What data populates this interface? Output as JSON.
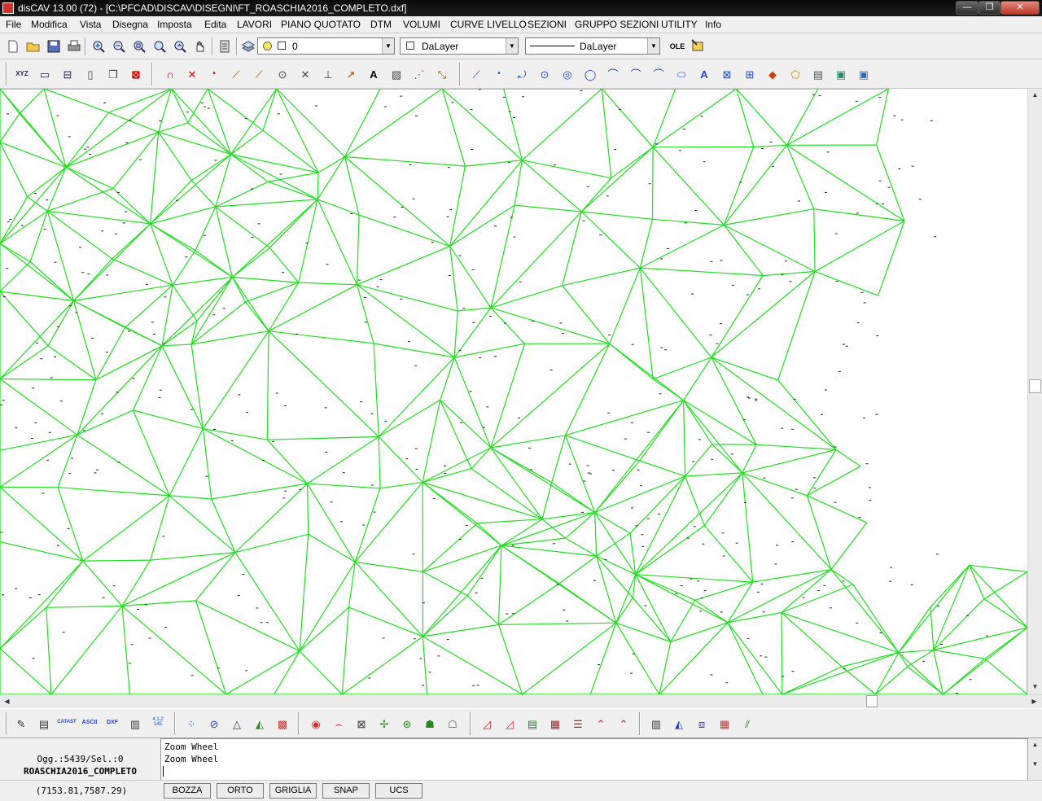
{
  "window": {
    "title": "disCAV 13.00 (72) - [C:\\PFCAD\\DISCAV\\DISEGNI\\FT_ROASCHIA2016_COMPLETO.dxf]",
    "minimize": "—",
    "restore": "❐",
    "close": "✕"
  },
  "menu": [
    "File",
    "Modifica",
    "Vista",
    "Disegna",
    "Imposta",
    "Edita",
    "LAVORI",
    "PIANO QUOTATO",
    "DTM",
    "VOLUMI",
    "CURVE LIVELLO",
    "SEZIONI",
    "GRUPPO SEZIONI",
    "UTILITY",
    "Info"
  ],
  "toolbar1": {
    "layer_value": "0",
    "color_value": "DaLayer",
    "linetype_value": "DaLayer",
    "ole_label": "OLE",
    "icons": [
      "new-icon",
      "open-icon",
      "save-icon",
      "print-icon",
      "zoom-in-icon",
      "zoom-out-icon",
      "zoom-window-icon",
      "zoom-extents-icon",
      "zoom-previous-icon",
      "pan-icon",
      "properties-icon",
      "layers-icon"
    ]
  },
  "toolbar2": {
    "icons": [
      "xyz-icon",
      "dimension-icon",
      "layer-tool-icon",
      "page-icon",
      "page-copy-icon",
      "delete-icon",
      "magnet-icon",
      "point-x-icon",
      "point-dot-icon",
      "line-icon",
      "line2-icon",
      "circle-icon",
      "cross-icon",
      "perpendicular-icon",
      "arrow-icon",
      "text-a-icon",
      "hatch-icon",
      "snap-end-icon",
      "snap-mid-icon",
      "osnap-line-icon",
      "osnap-point-icon",
      "osnap-curve-icon",
      "osnap-center-icon",
      "osnap-circle-icon",
      "osnap-tangent-icon",
      "osnap-arc-icon",
      "osnap-arc2-icon",
      "osnap-arc3-icon",
      "osnap-ellipse-icon",
      "text-tool-icon",
      "image-icon",
      "image-frame-icon",
      "fill-icon",
      "shapes-icon",
      "doc-icon",
      "doc2-icon",
      "doc3-icon"
    ]
  },
  "toolbar3": {
    "icons": [
      "import-icon",
      "table-import-icon",
      "catasto-icon",
      "ascii-icon",
      "dxf-icon",
      "list-icon",
      "numbers-icon",
      "dtm-points-icon",
      "dtm-edit-icon",
      "triangle-icon",
      "triangle-fill-icon",
      "grid-icon",
      "contour-icon",
      "contour2-icon",
      "contour-cut-icon",
      "contour-move-icon",
      "contour-fill-icon",
      "contour-fill2-icon",
      "contour-fill3-icon",
      "section-icon",
      "section2-icon",
      "section3-icon",
      "section4-icon",
      "table-icon",
      "profile-icon",
      "profile2-icon",
      "volume-table-icon",
      "volume-icon",
      "volume-3d-icon",
      "volume-report-icon",
      "volume-lines-icon"
    ],
    "labels": {
      "catasto": "CATAST",
      "ascii": "ASCII",
      "dxf": "DXF",
      "numbers": "4.1.2\n145"
    }
  },
  "info": {
    "objects": "Ogg.:5439/Sel.:0",
    "drawing": "ROASCHIA2016_COMPLETO"
  },
  "command_log": [
    "Zoom Wheel",
    "Zoom Wheel"
  ],
  "command_prompt": "",
  "status": {
    "coords": "(7153.81,7587.29)",
    "buttons": [
      "BOZZA",
      "ORTO",
      "GRIGLIA",
      "SNAP",
      "UCS"
    ]
  },
  "colors": {
    "mesh": "#22dd22",
    "canvas": "#ffffff",
    "point": "#222222"
  }
}
